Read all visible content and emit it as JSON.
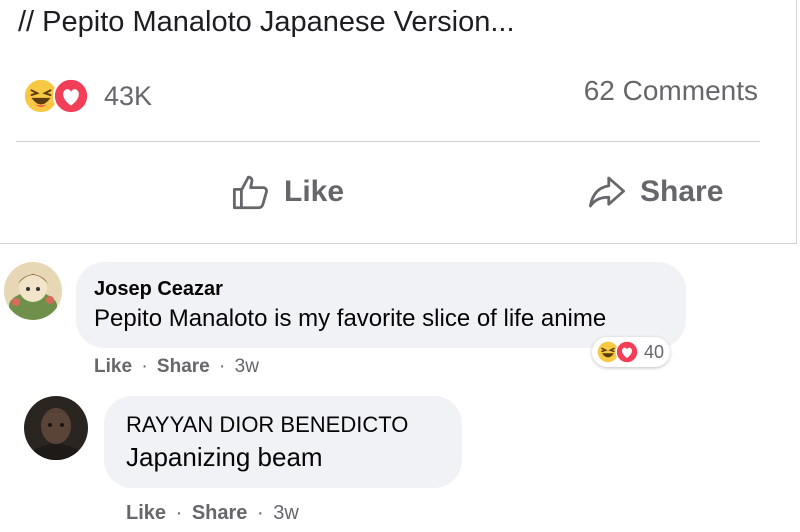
{
  "post": {
    "text": "// Pepito Manaloto Japanese Version...",
    "reactions": {
      "icons": [
        "haha-emoji-icon",
        "love-heart-icon"
      ],
      "count": "43K"
    },
    "comments_count": "62 Comments",
    "like_label": "Like",
    "share_label": "Share"
  },
  "comments": [
    {
      "author": "Josep Ceazar",
      "text": "Pepito Manaloto is my favorite slice of life anime",
      "like_label": "Like",
      "sep": "·",
      "share_label": "Share",
      "time": "3w",
      "reactions": {
        "icons": [
          "haha-emoji-icon",
          "love-heart-icon"
        ],
        "count": "40"
      }
    },
    {
      "author": "RAYYAN DIOR BENEDICTO",
      "text": "Japanizing beam",
      "like_label": "Like",
      "sep": "·",
      "share_label": "Share",
      "time": "3w"
    }
  ],
  "colors": {
    "haha_yellow": "#f7c844",
    "love_red": "#f33e58",
    "muted_text": "#65676b",
    "bubble_bg": "#f0f2f5",
    "divider": "#ced0d4"
  }
}
